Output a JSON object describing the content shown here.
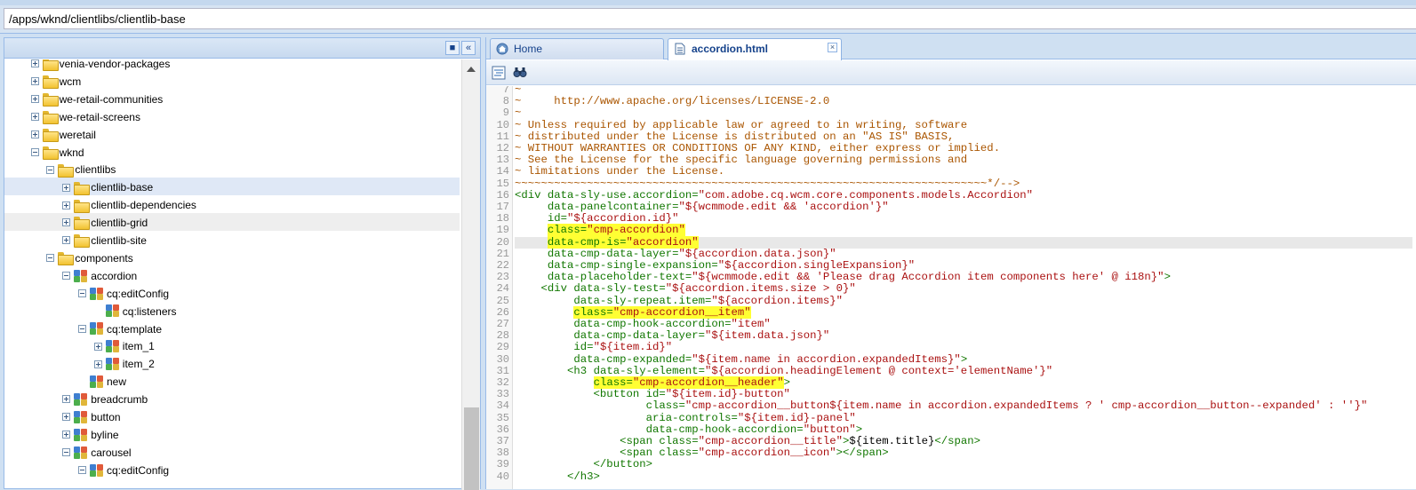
{
  "path": {
    "value": "/apps/wknd/clientlibs/clientlib-base"
  },
  "tree": {
    "nodes": [
      {
        "label": "venia-vendor-packages",
        "type": "folder",
        "depth": 2,
        "expander": "plus"
      },
      {
        "label": "wcm",
        "type": "folder",
        "depth": 2,
        "expander": "plus"
      },
      {
        "label": "we-retail-communities",
        "type": "folder",
        "depth": 2,
        "expander": "plus"
      },
      {
        "label": "we-retail-screens",
        "type": "folder",
        "depth": 2,
        "expander": "plus"
      },
      {
        "label": "weretail",
        "type": "folder",
        "depth": 2,
        "expander": "plus"
      },
      {
        "label": "wknd",
        "type": "folder",
        "depth": 2,
        "expander": "minus"
      },
      {
        "label": "clientlibs",
        "type": "folder",
        "depth": 3,
        "expander": "minus"
      },
      {
        "label": "clientlib-base",
        "type": "folder",
        "depth": 4,
        "expander": "plus",
        "state": "selected"
      },
      {
        "label": "clientlib-dependencies",
        "type": "folder",
        "depth": 4,
        "expander": "plus"
      },
      {
        "label": "clientlib-grid",
        "type": "folder",
        "depth": 4,
        "expander": "plus",
        "state": "hover"
      },
      {
        "label": "clientlib-site",
        "type": "folder",
        "depth": 4,
        "expander": "plus"
      },
      {
        "label": "components",
        "type": "folder",
        "depth": 3,
        "expander": "minus"
      },
      {
        "label": "accordion",
        "type": "component",
        "depth": 4,
        "expander": "minus"
      },
      {
        "label": "cq:editConfig",
        "type": "component",
        "depth": 5,
        "expander": "minus"
      },
      {
        "label": "cq:listeners",
        "type": "component",
        "depth": 6,
        "expander": "none"
      },
      {
        "label": "cq:template",
        "type": "component",
        "depth": 5,
        "expander": "minus"
      },
      {
        "label": "item_1",
        "type": "component",
        "depth": 6,
        "expander": "plus"
      },
      {
        "label": "item_2",
        "type": "component",
        "depth": 6,
        "expander": "plus"
      },
      {
        "label": "new",
        "type": "component",
        "depth": 5,
        "expander": "none"
      },
      {
        "label": "breadcrumb",
        "type": "component",
        "depth": 4,
        "expander": "plus"
      },
      {
        "label": "button",
        "type": "component",
        "depth": 4,
        "expander": "plus"
      },
      {
        "label": "byline",
        "type": "component",
        "depth": 4,
        "expander": "plus"
      },
      {
        "label": "carousel",
        "type": "component",
        "depth": 4,
        "expander": "minus"
      },
      {
        "label": "cq:editConfig",
        "type": "component",
        "depth": 5,
        "expander": "minus"
      }
    ]
  },
  "tabs": [
    {
      "label": "Home",
      "icon": "home-icon",
      "active": false
    },
    {
      "label": "accordion.html",
      "icon": "file-icon",
      "active": true
    }
  ],
  "editor": {
    "lines": [
      {
        "n": "7",
        "segs": [
          [
            "c-com",
            "~"
          ]
        ]
      },
      {
        "n": "8",
        "segs": [
          [
            "c-com",
            "~     http://www.apache.org/licenses/LICENSE-2.0"
          ]
        ]
      },
      {
        "n": "9",
        "segs": [
          [
            "c-com",
            "~"
          ]
        ]
      },
      {
        "n": "10",
        "segs": [
          [
            "c-com",
            "~ Unless required by applicable law or agreed to in writing, software"
          ]
        ]
      },
      {
        "n": "11",
        "segs": [
          [
            "c-com",
            "~ distributed under the License is distributed on an \"AS IS\" BASIS,"
          ]
        ]
      },
      {
        "n": "12",
        "segs": [
          [
            "c-com",
            "~ WITHOUT WARRANTIES OR CONDITIONS OF ANY KIND, either express or implied."
          ]
        ]
      },
      {
        "n": "13",
        "segs": [
          [
            "c-com",
            "~ See the License for the specific language governing permissions and"
          ]
        ]
      },
      {
        "n": "14",
        "segs": [
          [
            "c-com",
            "~ limitations under the License."
          ]
        ]
      },
      {
        "n": "15",
        "segs": [
          [
            "c-com",
            "~~~~~~~~~~~~~~~~~~~~~~~~~~~~~~~~~~~~~~~~~~~~~~~~~~~~~~~~~~~~~~~~~~~~~~~~*/-->"
          ]
        ]
      },
      {
        "n": "16",
        "segs": [
          [
            "c-tag",
            "<div "
          ],
          [
            "c-tag",
            "data-sly-use.accordion="
          ],
          [
            "c-str",
            "\"com.adobe.cq.wcm.core.components.models.Accordion\""
          ]
        ]
      },
      {
        "n": "17",
        "segs": [
          [
            "c-tag",
            "     data-panelcontainer="
          ],
          [
            "c-str",
            "\"${wcmmode.edit && 'accordion'}\""
          ]
        ]
      },
      {
        "n": "18",
        "segs": [
          [
            "c-tag",
            "     id="
          ],
          [
            "c-str",
            "\"${accordion.id}\""
          ]
        ]
      },
      {
        "n": "19",
        "segs": [
          [
            "c-tag",
            "     "
          ],
          [
            "c-tag hl",
            "class="
          ],
          [
            "c-str hl",
            "\"cmp-accordion\""
          ]
        ]
      },
      {
        "n": "20",
        "segs": [
          [
            "c-tag",
            "     "
          ],
          [
            "c-tag hl",
            "data-cmp-is="
          ],
          [
            "c-str hl",
            "\"accordion\""
          ]
        ],
        "active": true
      },
      {
        "n": "21",
        "segs": [
          [
            "c-tag",
            "     data-cmp-data-layer="
          ],
          [
            "c-str",
            "\"${accordion.data.json}\""
          ]
        ]
      },
      {
        "n": "22",
        "segs": [
          [
            "c-tag",
            "     data-cmp-single-expansion="
          ],
          [
            "c-str",
            "\"${accordion.singleExpansion}\""
          ]
        ]
      },
      {
        "n": "23",
        "segs": [
          [
            "c-tag",
            "     data-placeholder-text="
          ],
          [
            "c-str",
            "\"${wcmmode.edit && 'Please drag Accordion item components here' @ i18n}\""
          ],
          [
            "c-tag",
            ">"
          ]
        ]
      },
      {
        "n": "24",
        "segs": [
          [
            "c-tag",
            "    <div "
          ],
          [
            "c-tag",
            "data-sly-test="
          ],
          [
            "c-str",
            "\"${accordion.items.size > 0}\""
          ]
        ]
      },
      {
        "n": "25",
        "segs": [
          [
            "c-tag",
            "         data-sly-repeat.item="
          ],
          [
            "c-str",
            "\"${accordion.items}\""
          ]
        ]
      },
      {
        "n": "26",
        "segs": [
          [
            "c-tag",
            "         "
          ],
          [
            "c-tag hl",
            "class="
          ],
          [
            "c-str hl",
            "\"cmp-accordion__item\""
          ]
        ]
      },
      {
        "n": "27",
        "segs": [
          [
            "c-tag",
            "         data-cmp-hook-accordion="
          ],
          [
            "c-str",
            "\"item\""
          ]
        ]
      },
      {
        "n": "28",
        "segs": [
          [
            "c-tag",
            "         data-cmp-data-layer="
          ],
          [
            "c-str",
            "\"${item.data.json}\""
          ]
        ]
      },
      {
        "n": "29",
        "segs": [
          [
            "c-tag",
            "         id="
          ],
          [
            "c-str",
            "\"${item.id}\""
          ]
        ]
      },
      {
        "n": "30",
        "segs": [
          [
            "c-tag",
            "         data-cmp-expanded="
          ],
          [
            "c-str",
            "\"${item.name in accordion.expandedItems}\""
          ],
          [
            "c-tag",
            ">"
          ]
        ]
      },
      {
        "n": "31",
        "segs": [
          [
            "c-tag",
            "        <h3 "
          ],
          [
            "c-tag",
            "data-sly-element="
          ],
          [
            "c-str",
            "\"${accordion.headingElement @ context='elementName'}\""
          ]
        ]
      },
      {
        "n": "32",
        "segs": [
          [
            "c-tag",
            "            "
          ],
          [
            "c-tag hl",
            "class="
          ],
          [
            "c-str hl",
            "\"cmp-accordion__header\""
          ],
          [
            "c-tag",
            ">"
          ]
        ]
      },
      {
        "n": "33",
        "segs": [
          [
            "c-tag",
            "            <button "
          ],
          [
            "c-tag",
            "id="
          ],
          [
            "c-str",
            "\"${item.id}-button\""
          ]
        ]
      },
      {
        "n": "34",
        "segs": [
          [
            "c-tag",
            "                    class="
          ],
          [
            "c-str",
            "\"cmp-accordion__button${item.name in accordion.expandedItems ? ' cmp-accordion__button--expanded' : ''}\""
          ]
        ]
      },
      {
        "n": "35",
        "segs": [
          [
            "c-tag",
            "                    aria-controls="
          ],
          [
            "c-str",
            "\"${item.id}-panel\""
          ]
        ]
      },
      {
        "n": "36",
        "segs": [
          [
            "c-tag",
            "                    data-cmp-hook-accordion="
          ],
          [
            "c-str",
            "\"button\""
          ],
          [
            "c-tag",
            ">"
          ]
        ]
      },
      {
        "n": "37",
        "segs": [
          [
            "c-tag",
            "                <span "
          ],
          [
            "c-tag",
            "class="
          ],
          [
            "c-str",
            "\"cmp-accordion__title\""
          ],
          [
            "c-tag",
            ">"
          ],
          [
            "c-attr",
            "${item.title}"
          ],
          [
            "c-tag",
            "</span>"
          ]
        ]
      },
      {
        "n": "38",
        "segs": [
          [
            "c-tag",
            "                <span "
          ],
          [
            "c-tag",
            "class="
          ],
          [
            "c-str",
            "\"cmp-accordion__icon\""
          ],
          [
            "c-tag",
            "></span>"
          ]
        ]
      },
      {
        "n": "39",
        "segs": [
          [
            "c-tag",
            "            </button>"
          ]
        ]
      },
      {
        "n": "40",
        "segs": [
          [
            "c-tag",
            "        </h3>"
          ]
        ]
      }
    ]
  },
  "colors": {
    "highlight": "#ffff33",
    "comment": "#aa5500",
    "string": "#aa1111",
    "tag": "#117700"
  }
}
